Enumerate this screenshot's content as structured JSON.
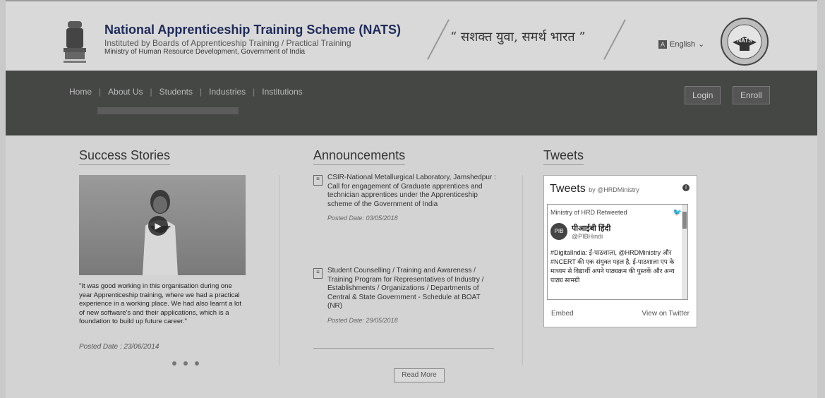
{
  "header": {
    "title": "National Apprenticeship Training Scheme (NATS)",
    "subtitle": "Instituted by Boards of Apprenticeship Training / Practical Training",
    "ministry": "Ministry of Human Resource Development, Government of India",
    "slogan": "“ सशक्त युवा, समर्थ भारत ”",
    "language": "English",
    "logo_text": "NATS"
  },
  "nav": {
    "items": [
      "Home",
      "About Us",
      "Students",
      "Industries",
      "Institutions"
    ],
    "login": "Login",
    "enroll": "Enroll"
  },
  "success": {
    "title": "Success Stories",
    "quote": "\"It was good working in this organisation during one year Apprenticeship training, where we had a practical experience in a working place. We had also learnt a lot of new software's and their applications, which is a foundation to build up future career.\"",
    "date": "Posted Date : 23/06/2014"
  },
  "announcements": {
    "title": "Announcements",
    "items": [
      {
        "text": "CSIR-National Metallurgical Laboratory, Jamshedpur :  Call for engagement of Graduate apprentices and technician apprentices under the Apprenticeship scheme of the Government of India",
        "date": "Posted Date: 03/05/2018"
      },
      {
        "text": "Student Counselling / Training and Awareness / Training Program for Representatives of Industry / Establishments / Organizations / Departments of Central & State Government - Schedule at BOAT (NR)",
        "date": "Posted Date: 29/05/2018"
      }
    ],
    "read_more": "Read More"
  },
  "tweets": {
    "title": "Tweets",
    "widget_title": "Tweets",
    "widget_by": "by @HRDMinistry",
    "retweet": "Ministry of HRD Retweeted",
    "author_name": "पीआईबी हिंदी",
    "author_handle": "@PIBHindi",
    "body": "#DigitalIndia: ई-पाठशाला, @HRDMinistry और #NCERT की एक संयुक्त पहल है, ई-पाठशाला एप के माध्यम से विद्यार्थी अपने पाठ्यक्रम की पुस्तकें और अन्य पाठ्य सामग्री",
    "embed": "Embed",
    "view": "View on Twitter"
  }
}
